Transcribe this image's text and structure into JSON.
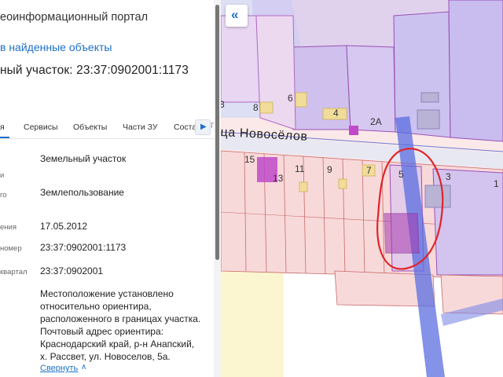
{
  "panel": {
    "portal_title": "еоинформационный портал",
    "back_link": "в найденные объекты",
    "parcel_title": "ный участок: 23:37:0902001:1173",
    "tabs": [
      "я",
      "Сервисы",
      "Объекты",
      "Части ЗУ",
      "Соста"
    ],
    "tabs_next_icon": "chevron-right-icon",
    "tabs_overflow_text": "Г",
    "rows": [
      {
        "label": "",
        "value": "Земельный участок"
      },
      {
        "label": "и",
        "value": ""
      },
      {
        "label": "го",
        "value": "Землепользование"
      },
      {
        "label": "ения",
        "value": "17.05.2012"
      },
      {
        "label": "номер",
        "value": "23:37:0902001:1173"
      },
      {
        "label": "квартал",
        "value": "23:37:0902001"
      }
    ],
    "location_lines": [
      "Местоположение установлено",
      "относительно ориентира,",
      "расположенного в границах участка.",
      "Почтовый адрес ориентира:",
      "Краснодарский край, р-н Анапский,",
      "х. Рассвет, ул. Новоселов, 5а."
    ],
    "collapse_link": "Свернуть",
    "collapse_arrow": "∧"
  },
  "map": {
    "collapse_button_icon": "double-chevron-left-icon",
    "collapse_button_glyph": "«",
    "street_label": "ца Новосёлов",
    "house_numbers": [
      "8",
      "6",
      "4",
      "2А",
      "15",
      "13",
      "11",
      "9",
      "7",
      "5",
      "3",
      "1",
      "8"
    ]
  },
  "colors": {
    "accent": "#1e6fc8",
    "parcel_fill": "#f7d6d6",
    "parcel_border": "#a63ab0",
    "road": "#5b6ee0",
    "selection": "#e0252a"
  }
}
